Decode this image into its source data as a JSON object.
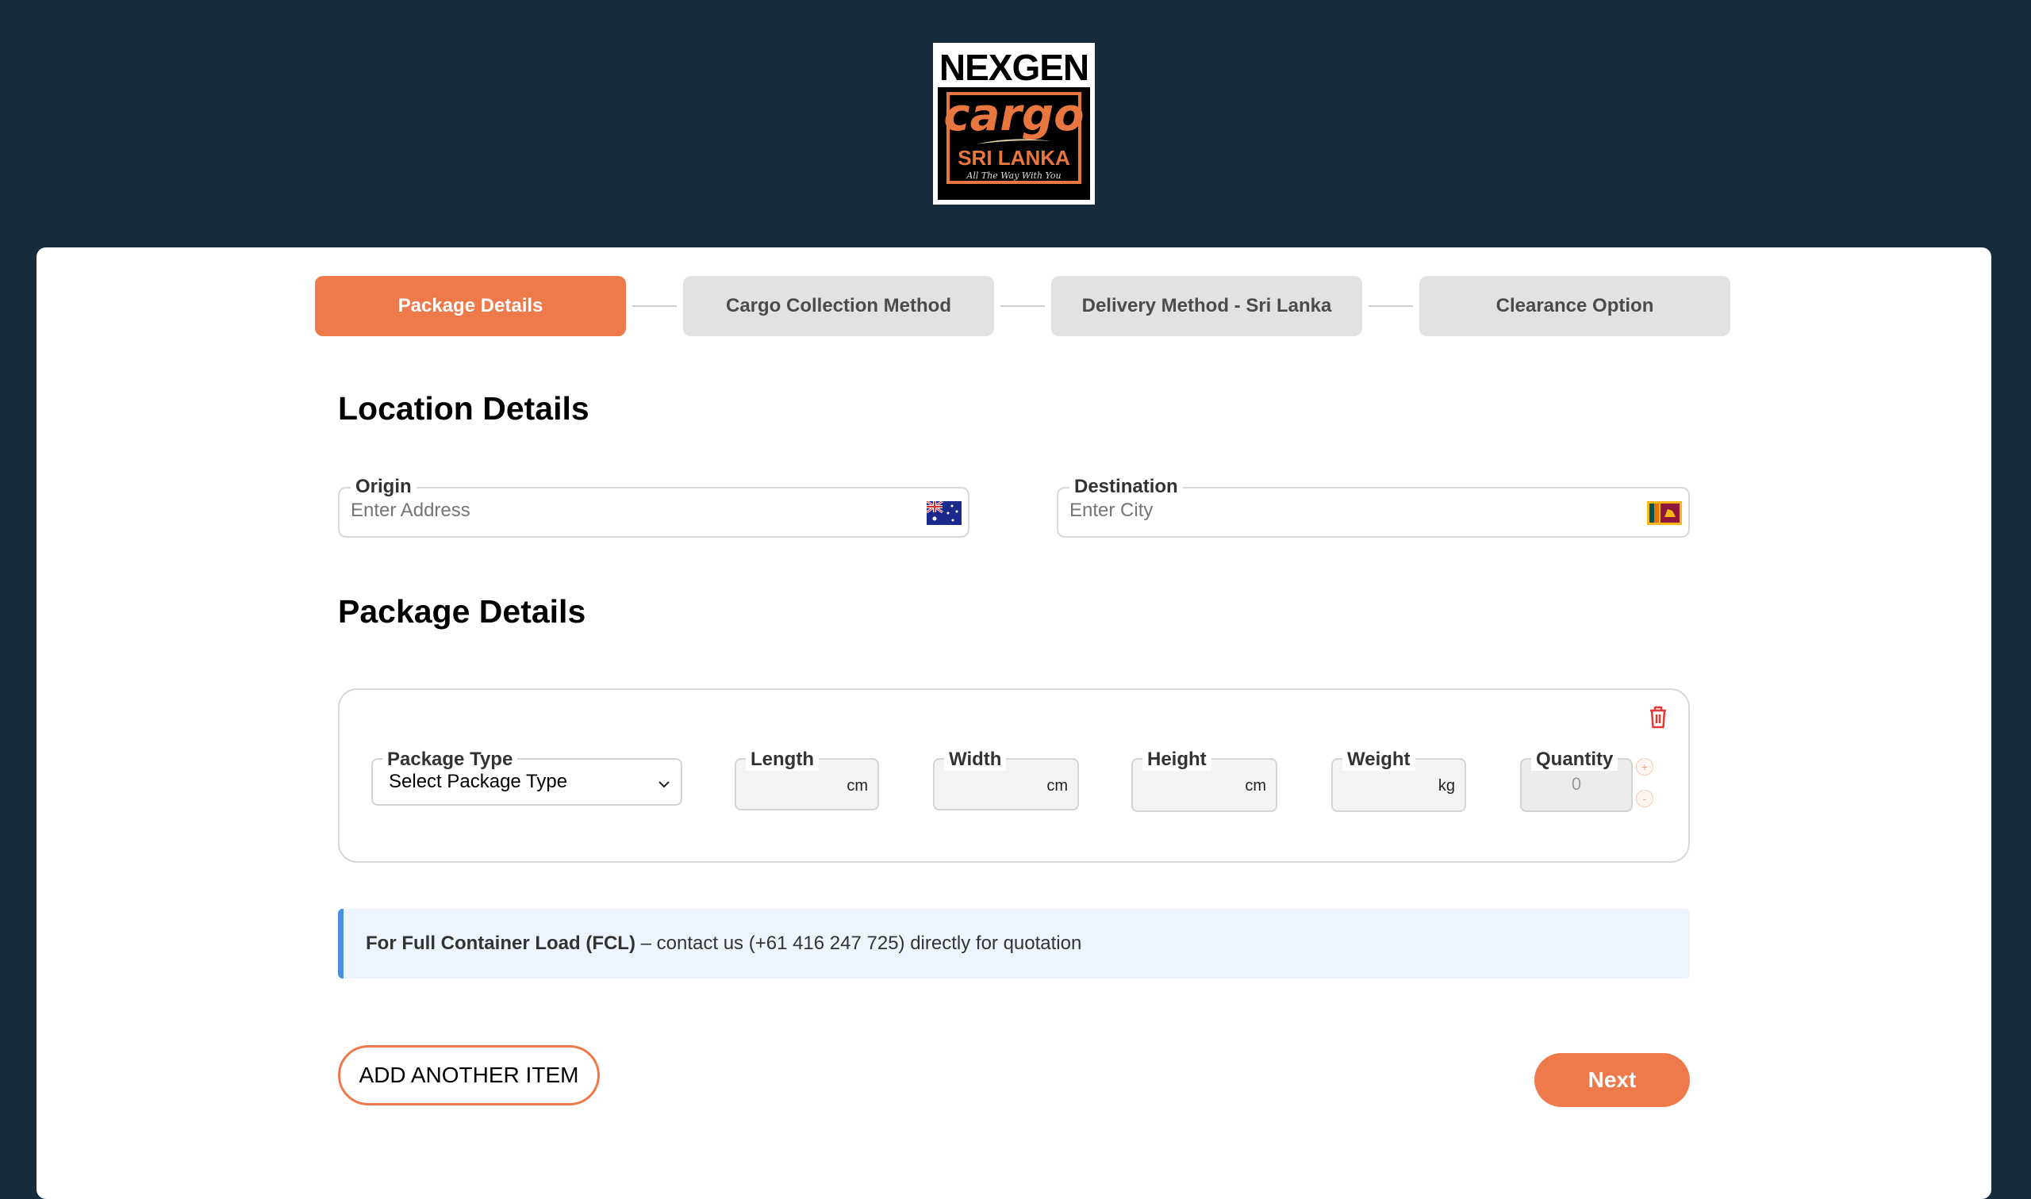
{
  "logo": {
    "top_text": "NEXGEN",
    "main_text": "cargo",
    "sub_text": "SRI LANKA",
    "tagline": "All The Way With You"
  },
  "steps": [
    {
      "label": "Package Details",
      "active": true
    },
    {
      "label": "Cargo Collection Method",
      "active": false
    },
    {
      "label": "Delivery Method - Sri Lanka",
      "active": false
    },
    {
      "label": "Clearance Option",
      "active": false
    }
  ],
  "location": {
    "title": "Location Details",
    "origin": {
      "label": "Origin",
      "placeholder": "Enter Address",
      "flag_icon": "australia-flag-icon"
    },
    "destination": {
      "label": "Destination",
      "placeholder": "Enter City",
      "flag_icon": "sri-lanka-flag-icon"
    }
  },
  "package": {
    "title": "Package Details",
    "type": {
      "label": "Package Type",
      "value": "Select Package Type"
    },
    "length": {
      "label": "Length",
      "unit": "cm"
    },
    "width": {
      "label": "Width",
      "unit": "cm"
    },
    "height": {
      "label": "Height",
      "unit": "cm"
    },
    "weight": {
      "label": "Weight",
      "unit": "kg"
    },
    "quantity": {
      "label": "Quantity",
      "value": "0",
      "plus": "+",
      "minus": "-"
    }
  },
  "notice": {
    "bold": "For Full Container Load (FCL)",
    "text": " – contact us (+61 416 247 725) directly for quotation"
  },
  "buttons": {
    "add_item": "ADD ANOTHER ITEM",
    "next": "Next"
  },
  "colors": {
    "background": "#162c3a",
    "accent": "#ee7a4c",
    "notice_border": "#4a90e2",
    "notice_bg": "#edf4fd",
    "delete": "#e53935"
  }
}
